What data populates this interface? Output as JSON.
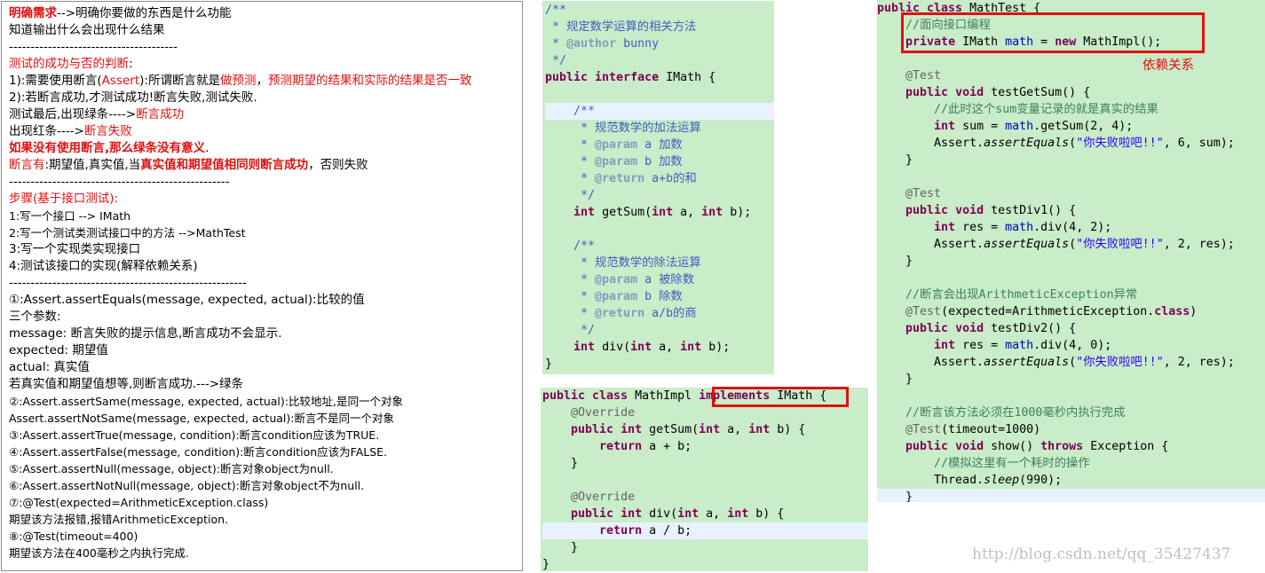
{
  "notes": [
    [
      {
        "t": "明确需求",
        "c": "red bold"
      },
      {
        "t": "-->明确你要做的东西是什么功能"
      }
    ],
    [
      {
        "t": "知道输出什么会出现什么结果"
      }
    ],
    [
      {
        "t": "---------------------------------------"
      }
    ],
    [
      {
        "t": "测试的成功与否的判断",
        "c": "red"
      },
      {
        "t": ":"
      }
    ],
    [
      {
        "t": "   1):需要使用断言("
      },
      {
        "t": "Assert",
        "c": "red"
      },
      {
        "t": "):所谓断言就是"
      },
      {
        "t": "做预测",
        "c": "red"
      },
      {
        "t": "，"
      },
      {
        "t": "预测期望的结果和实际的结果是否一致",
        "c": "red"
      }
    ],
    [
      {
        "t": "   2):若断言成功,才测试成功!断言失败,测试失败."
      }
    ],
    [
      {
        "t": "      测试最后,出现绿条---->"
      },
      {
        "t": "断言成功",
        "c": "red"
      }
    ],
    [
      {
        "t": "      出现红条---->"
      },
      {
        "t": "断言失败",
        "c": "red"
      }
    ],
    [
      {
        "t": "   如果没有使用断言,那么绿条没有意义",
        "c": "red bold"
      },
      {
        "t": "."
      }
    ],
    [
      {
        "t": "断言有",
        "c": "red"
      },
      {
        "t": ":期望值,真实值,当"
      },
      {
        "t": "真实值和期望值相同则断言成功",
        "c": "red bold"
      },
      {
        "t": "，否则失败"
      }
    ],
    [
      {
        "t": "---------------------------------------------------"
      }
    ],
    [
      {
        "t": "步骤(基于接口测试):",
        "c": "red"
      }
    ],
    [
      {
        "t": "   1:写一个接口 --> IMath",
        "s": 1
      }
    ],
    [
      {
        "t": "   2:写一个测试类测试接口中的方法 -->MathTest",
        "s": 1
      }
    ],
    [
      {
        "t": "   3:写一个实现类实现接口"
      }
    ],
    [
      {
        "t": "   4:测试该接口的实现(解释依赖关系)"
      }
    ],
    [
      {
        "t": "-------------------------------------------------------"
      }
    ],
    [
      {
        "t": "①:Assert.assertEquals(message, expected, actual):比较的值"
      }
    ],
    [
      {
        "t": "   三个参数:"
      }
    ],
    [
      {
        "t": "   message: 断言失败的提示信息,断言成功不会显示."
      }
    ],
    [
      {
        "t": "   expected: 期望值"
      }
    ],
    [
      {
        "t": "   actual:   真实值"
      }
    ],
    [
      {
        "t": "  若真实值和期望值想等,则断言成功.--->绿条"
      }
    ],
    [
      {
        "t": "②:Assert.assertSame(message, expected, actual):比较地址,是同一个对象",
        "s": 1
      }
    ],
    [
      {
        "t": "   Assert.assertNotSame(message, expected, actual):断言不是同一个对象",
        "s": 1
      }
    ],
    [
      {
        "t": "③:Assert.assertTrue(message, condition):断言condition应该为TRUE.",
        "s": 1
      }
    ],
    [
      {
        "t": "④:Assert.assertFalse(message, condition):断言condition应该为FALSE.",
        "s": 1
      }
    ],
    [
      {
        "t": "⑤:Assert.assertNull(message, object):断言对象object为null.",
        "s": 1
      }
    ],
    [
      {
        "t": "⑥:Assert.assertNotNull(message, object):断言对象object不为null.",
        "s": 1
      }
    ],
    [
      {
        "t": "⑦:@Test(expected=ArithmeticException.class)",
        "s": 1
      }
    ],
    [
      {
        "t": "  期望该方法报错,报错ArithmeticException.",
        "s": 1
      }
    ],
    [
      {
        "t": "⑧:@Test(timeout=400)",
        "s": 1
      }
    ],
    [
      {
        "t": "  期望该方法在400毫秒之内执行完成.",
        "s": 1
      }
    ]
  ],
  "code_imath": [
    {
      "s": [
        {
          "t": "/**",
          "c": "jd"
        }
      ]
    },
    {
      "s": [
        {
          "t": " * 规定数学运算的相关方法",
          "c": "jd"
        }
      ]
    },
    {
      "s": [
        {
          "t": " * ",
          "c": "jd"
        },
        {
          "t": "@author",
          "c": "tag"
        },
        {
          "t": " bunny",
          "c": "jd"
        }
      ]
    },
    {
      "s": [
        {
          "t": " */",
          "c": "jd"
        }
      ]
    },
    {
      "s": [
        {
          "t": "public interface",
          "c": "kw"
        },
        {
          "t": " IMath {"
        }
      ]
    },
    {
      "s": [
        {
          "t": ""
        }
      ]
    },
    {
      "s": [
        {
          "t": "    "
        },
        {
          "t": "/**",
          "c": "jd"
        }
      ],
      "hl": true
    },
    {
      "s": [
        {
          "t": "     * 规范数学的加法运算",
          "c": "jd"
        }
      ]
    },
    {
      "s": [
        {
          "t": "     * ",
          "c": "jd"
        },
        {
          "t": "@param",
          "c": "tag"
        },
        {
          "t": " a 加数",
          "c": "jd"
        }
      ]
    },
    {
      "s": [
        {
          "t": "     * ",
          "c": "jd"
        },
        {
          "t": "@param",
          "c": "tag"
        },
        {
          "t": " b 加数",
          "c": "jd"
        }
      ]
    },
    {
      "s": [
        {
          "t": "     * ",
          "c": "jd"
        },
        {
          "t": "@return",
          "c": "tag"
        },
        {
          "t": " a+b的和",
          "c": "jd"
        }
      ]
    },
    {
      "s": [
        {
          "t": "     */",
          "c": "jd"
        }
      ]
    },
    {
      "s": [
        {
          "t": "    "
        },
        {
          "t": "int",
          "c": "kw"
        },
        {
          "t": " getSum("
        },
        {
          "t": "int",
          "c": "kw"
        },
        {
          "t": " a, "
        },
        {
          "t": "int",
          "c": "kw"
        },
        {
          "t": " b);"
        }
      ]
    },
    {
      "s": [
        {
          "t": ""
        }
      ]
    },
    {
      "s": [
        {
          "t": "    "
        },
        {
          "t": "/**",
          "c": "jd"
        }
      ]
    },
    {
      "s": [
        {
          "t": "     * 规范数学的除法运算",
          "c": "jd"
        }
      ]
    },
    {
      "s": [
        {
          "t": "     * ",
          "c": "jd"
        },
        {
          "t": "@param",
          "c": "tag"
        },
        {
          "t": " a 被除数",
          "c": "jd"
        }
      ]
    },
    {
      "s": [
        {
          "t": "     * ",
          "c": "jd"
        },
        {
          "t": "@param",
          "c": "tag"
        },
        {
          "t": " b 除数",
          "c": "jd"
        }
      ]
    },
    {
      "s": [
        {
          "t": "     * ",
          "c": "jd"
        },
        {
          "t": "@return",
          "c": "tag"
        },
        {
          "t": " a/b的商",
          "c": "jd"
        }
      ]
    },
    {
      "s": [
        {
          "t": "     */",
          "c": "jd"
        }
      ]
    },
    {
      "s": [
        {
          "t": "    "
        },
        {
          "t": "int",
          "c": "kw"
        },
        {
          "t": " div("
        },
        {
          "t": "int",
          "c": "kw"
        },
        {
          "t": " a, "
        },
        {
          "t": "int",
          "c": "kw"
        },
        {
          "t": " b);"
        }
      ]
    },
    {
      "s": [
        {
          "t": "}"
        }
      ]
    }
  ],
  "code_impl": [
    {
      "s": [
        {
          "t": "public class",
          "c": "kw"
        },
        {
          "t": " MathImpl "
        },
        {
          "t": "implements",
          "c": "kw"
        },
        {
          "t": " IMath {"
        }
      ]
    },
    {
      "s": [
        {
          "t": "    "
        },
        {
          "t": "@Override",
          "c": "an"
        }
      ]
    },
    {
      "s": [
        {
          "t": "    "
        },
        {
          "t": "public int",
          "c": "kw"
        },
        {
          "t": " getSum("
        },
        {
          "t": "int",
          "c": "kw"
        },
        {
          "t": " a, "
        },
        {
          "t": "int",
          "c": "kw"
        },
        {
          "t": " b) {"
        }
      ]
    },
    {
      "s": [
        {
          "t": "        "
        },
        {
          "t": "return",
          "c": "kw"
        },
        {
          "t": " a + b;"
        }
      ]
    },
    {
      "s": [
        {
          "t": "    }"
        }
      ]
    },
    {
      "s": [
        {
          "t": ""
        }
      ]
    },
    {
      "s": [
        {
          "t": "    "
        },
        {
          "t": "@Override",
          "c": "an"
        }
      ]
    },
    {
      "s": [
        {
          "t": "    "
        },
        {
          "t": "public int",
          "c": "kw"
        },
        {
          "t": " div("
        },
        {
          "t": "int",
          "c": "kw"
        },
        {
          "t": " a, "
        },
        {
          "t": "int",
          "c": "kw"
        },
        {
          "t": " b) {"
        }
      ]
    },
    {
      "s": [
        {
          "t": "        "
        },
        {
          "t": "return",
          "c": "kw"
        },
        {
          "t": " a / b;"
        }
      ],
      "hl": true
    },
    {
      "s": [
        {
          "t": "    }"
        }
      ]
    },
    {
      "s": [
        {
          "t": "}"
        }
      ]
    }
  ],
  "code_test": [
    {
      "s": [
        {
          "t": "public class",
          "c": "kw"
        },
        {
          "t": " MathTest {"
        }
      ]
    },
    {
      "s": [
        {
          "t": "    "
        },
        {
          "t": "//面向接口编程",
          "c": "cm"
        }
      ]
    },
    {
      "s": [
        {
          "t": "    "
        },
        {
          "t": "private",
          "c": "kw"
        },
        {
          "t": " IMath "
        },
        {
          "t": "math",
          "c": "fd"
        },
        {
          "t": " = "
        },
        {
          "t": "new",
          "c": "kw"
        },
        {
          "t": " MathImpl();"
        }
      ]
    },
    {
      "s": [
        {
          "t": ""
        }
      ]
    },
    {
      "s": [
        {
          "t": "    "
        },
        {
          "t": "@Test",
          "c": "an"
        }
      ]
    },
    {
      "s": [
        {
          "t": "    "
        },
        {
          "t": "public void",
          "c": "kw"
        },
        {
          "t": " testGetSum() {"
        }
      ]
    },
    {
      "s": [
        {
          "t": "        "
        },
        {
          "t": "//此时这个sum变量记录的就是真实的结果",
          "c": "cm"
        }
      ]
    },
    {
      "s": [
        {
          "t": "        "
        },
        {
          "t": "int",
          "c": "kw"
        },
        {
          "t": " sum = "
        },
        {
          "t": "math",
          "c": "fd"
        },
        {
          "t": ".getSum(2, 4);"
        }
      ]
    },
    {
      "s": [
        {
          "t": "        Assert."
        },
        {
          "t": "assertEquals",
          "c": "it"
        },
        {
          "t": "("
        },
        {
          "t": "\"你失败啦吧!!\"",
          "c": "st"
        },
        {
          "t": ", 6, sum);"
        }
      ]
    },
    {
      "s": [
        {
          "t": "    }"
        }
      ]
    },
    {
      "s": [
        {
          "t": ""
        }
      ]
    },
    {
      "s": [
        {
          "t": "    "
        },
        {
          "t": "@Test",
          "c": "an"
        }
      ]
    },
    {
      "s": [
        {
          "t": "    "
        },
        {
          "t": "public void",
          "c": "kw"
        },
        {
          "t": " testDiv1() {"
        }
      ]
    },
    {
      "s": [
        {
          "t": "        "
        },
        {
          "t": "int",
          "c": "kw"
        },
        {
          "t": " res = "
        },
        {
          "t": "math",
          "c": "fd"
        },
        {
          "t": ".div(4, 2);"
        }
      ]
    },
    {
      "s": [
        {
          "t": "        Assert."
        },
        {
          "t": "assertEquals",
          "c": "it"
        },
        {
          "t": "("
        },
        {
          "t": "\"你失败啦吧!!\"",
          "c": "st"
        },
        {
          "t": ", 2, res);"
        }
      ]
    },
    {
      "s": [
        {
          "t": "    }"
        }
      ]
    },
    {
      "s": [
        {
          "t": ""
        }
      ]
    },
    {
      "s": [
        {
          "t": "    "
        },
        {
          "t": "//断言会出现ArithmeticException异常",
          "c": "cm"
        }
      ]
    },
    {
      "s": [
        {
          "t": "    "
        },
        {
          "t": "@Test",
          "c": "an"
        },
        {
          "t": "(expected=ArithmeticException."
        },
        {
          "t": "class",
          "c": "kw"
        },
        {
          "t": ")"
        }
      ]
    },
    {
      "s": [
        {
          "t": "    "
        },
        {
          "t": "public void",
          "c": "kw"
        },
        {
          "t": " testDiv2() {"
        }
      ]
    },
    {
      "s": [
        {
          "t": "        "
        },
        {
          "t": "int",
          "c": "kw"
        },
        {
          "t": " res = "
        },
        {
          "t": "math",
          "c": "fd"
        },
        {
          "t": ".div(4, 0);"
        }
      ]
    },
    {
      "s": [
        {
          "t": "        Assert."
        },
        {
          "t": "assertEquals",
          "c": "it"
        },
        {
          "t": "("
        },
        {
          "t": "\"你失败啦吧!!\"",
          "c": "st"
        },
        {
          "t": ", 2, res);"
        }
      ]
    },
    {
      "s": [
        {
          "t": "    }"
        }
      ]
    },
    {
      "s": [
        {
          "t": ""
        }
      ]
    },
    {
      "s": [
        {
          "t": "    "
        },
        {
          "t": "//断言该方法必须在1000毫秒内执行完成",
          "c": "cm"
        }
      ]
    },
    {
      "s": [
        {
          "t": "    "
        },
        {
          "t": "@Test",
          "c": "an"
        },
        {
          "t": "(timeout=1000)"
        }
      ]
    },
    {
      "s": [
        {
          "t": "    "
        },
        {
          "t": "public void",
          "c": "kw"
        },
        {
          "t": " show() "
        },
        {
          "t": "throws",
          "c": "kw"
        },
        {
          "t": " Exception {"
        }
      ]
    },
    {
      "s": [
        {
          "t": "        "
        },
        {
          "t": "//模拟这里有一个耗时的操作",
          "c": "cm"
        }
      ]
    },
    {
      "s": [
        {
          "t": "        Thread."
        },
        {
          "t": "sleep",
          "c": "it"
        },
        {
          "t": "(990);"
        }
      ]
    },
    {
      "s": [
        {
          "t": "    }"
        }
      ],
      "hl": true
    }
  ],
  "dependency_label": "依赖关系",
  "watermark": "http://blog.csdn.net/qq_35427437"
}
